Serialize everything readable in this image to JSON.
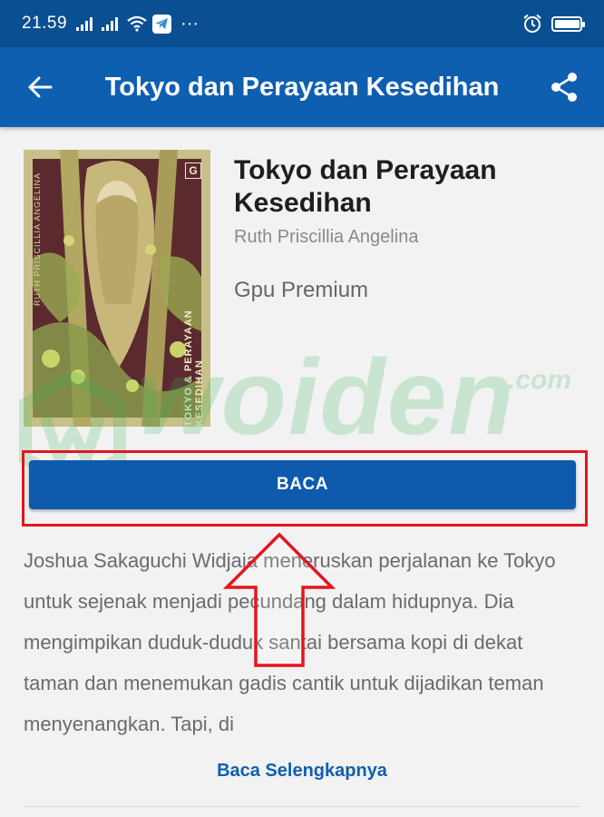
{
  "status_bar": {
    "time": "21.59",
    "icons": [
      "signal-icon",
      "signal-icon",
      "wifi-icon",
      "telegram-icon",
      "more-icon",
      "alarm-icon",
      "battery-icon"
    ],
    "battery_level": 0.9
  },
  "app_bar": {
    "title": "Tokyo dan Perayaan Kesedihan",
    "back_icon": "arrow-left-icon",
    "share_icon": "share-icon"
  },
  "book": {
    "title": "Tokyo dan Perayaan Kesedihan",
    "author": "Ruth Priscillia Angelina",
    "category": "Gpu Premium",
    "cover_author_text": "RUTH PRISCILLIA ANGELINA",
    "cover_title_text": "TOKYO & PERAYAAN KESEDIHAN",
    "cover_logo_text": "G"
  },
  "read_button": {
    "label": "BACA"
  },
  "description": "Joshua Sakaguchi Widjaja meneruskan perjalanan ke Tokyo untuk sejenak menjadi pecundang dalam hidupnya. Dia mengimpikan duduk-duduk santai bersama kopi di dekat taman dan menemukan gadis cantik untuk dijadikan teman menyenangkan. Tapi, di",
  "read_more": {
    "label": "Baca Selengkapnya"
  },
  "watermark": {
    "text": "woiden",
    "suffix": ".com"
  },
  "colors": {
    "status_bar": "#0b4f93",
    "app_bar": "#0f5fb0",
    "button": "#0e5aad",
    "highlight": "#e4151f",
    "watermark": "#3cb55d"
  }
}
